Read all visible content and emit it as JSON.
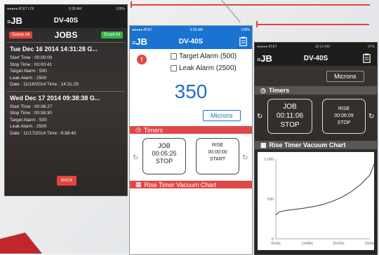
{
  "phone1": {
    "status": {
      "carrier": "●●●●● AT&T  LTE",
      "time": "9:38 AM",
      "battery": "100%"
    },
    "brand": "JB",
    "title": "DV-40S",
    "delete_all": "Delete All",
    "jobs_title": "JOBS",
    "email_all": "Email All",
    "jobs": [
      {
        "header": "Tue Dec 16 2014 14:31:28 G...",
        "start": "Start Time : 00:00:00",
        "stop": "Stop Time : 00:00:41",
        "target": "Target Alarm : 500",
        "leak": "Leak Alarm : 2500",
        "date": "Date : 11/16/2014 Time : 14:31:29"
      },
      {
        "header": "Wed Dec 17 2014 09:38:38 G...",
        "start": "Start Time : 00:08:27",
        "stop": "Stop Time : 00:08:30",
        "target": "Target Alarm : 500",
        "leak": "Leak Alarm : 2500",
        "date": "Date : 11/17/2014 Time : 9:38:40"
      }
    ],
    "back": "BACK"
  },
  "phone2": {
    "status": {
      "carrier": "●●●●● AT&T",
      "time": "9:35 AM",
      "battery": "100%"
    },
    "brand": "JB",
    "title": "DV-40S",
    "target_alarm": "Target Alarm (500)",
    "leak_alarm": "Leak Alarm (2500)",
    "reading": "350",
    "units": "Microns",
    "timers_label": "Timers",
    "job_timer": {
      "label": "JOB",
      "time": "00:05:25",
      "action": "STOP"
    },
    "rise_timer": {
      "label": "RISE",
      "time": "00:00:00",
      "action": "START"
    },
    "chart_label": "Rise Timer Vacuum Chart"
  },
  "phone3": {
    "status": {
      "carrier": "●●●●● AT&T",
      "time": "10:10 AM",
      "battery": "97%"
    },
    "brand": "JB",
    "title": "DV-40S",
    "units": "Microns",
    "timers_label": "Timers",
    "job_timer": {
      "label": "JOB",
      "time": "00:11:06",
      "action": "STOP"
    },
    "rise_timer": {
      "label": "RISE",
      "time": "00:06:09",
      "action": "STOP"
    },
    "chart_label": "Rise Timer Vacuum Chart"
  },
  "chart_data": {
    "type": "line",
    "title": "Rise Timer Vacuum Chart",
    "xlabel": "",
    "ylabel": "",
    "x_ticks": [
      "0m0s",
      "1m40s",
      "3m20s",
      "5m0s"
    ],
    "y_ticks": [
      "0",
      "500",
      "1,000"
    ],
    "ylim": [
      0,
      1000
    ],
    "xlim_seconds": [
      0,
      300
    ],
    "series": [
      {
        "x": [
          0,
          10,
          30,
          60,
          90,
          120,
          150,
          180,
          210,
          240,
          270,
          300,
          320
        ],
        "y": [
          300,
          335,
          355,
          370,
          385,
          405,
          430,
          470,
          520,
          590,
          680,
          800,
          1000
        ]
      }
    ],
    "grid": false
  },
  "colors": {
    "blue": "#1a73d0",
    "red": "#e04848",
    "green": "#34b04a"
  }
}
